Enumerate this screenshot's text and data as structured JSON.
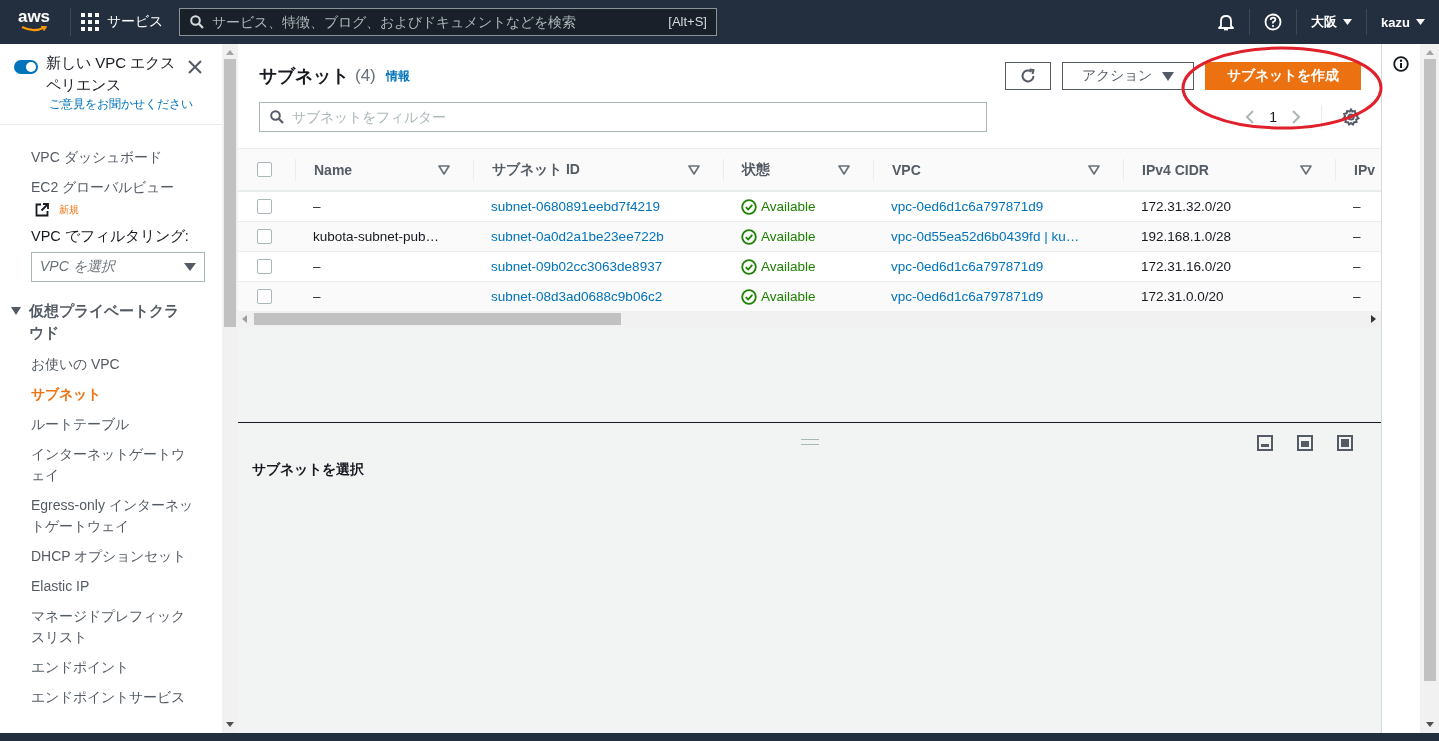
{
  "top_nav": {
    "logo": "aws",
    "services": "サービス",
    "search": {
      "placeholder": "サービス、特徴、ブログ、およびドキュメントなどを検索",
      "shortcut": "[Alt+S]"
    },
    "region": "大阪",
    "user": "kazu"
  },
  "sidebar": {
    "experience": {
      "label": "新しい VPC エクスペリエンス",
      "on": true,
      "feedback": "ご意見をお聞かせください"
    },
    "links": [
      {
        "label": "VPC ダッシュボード"
      },
      {
        "label": "EC2 グローバルビュー",
        "badge": "新規"
      }
    ],
    "filter": {
      "label": "VPC でフィルタリング:",
      "placeholder": "VPC を選択"
    },
    "section": {
      "label": "仮想プライベートクラウド",
      "expanded": true,
      "children": [
        {
          "label": "お使いの VPC",
          "selected": false
        },
        {
          "label": "サブネット",
          "selected": true
        },
        {
          "label": "ルートテーブル",
          "selected": false
        },
        {
          "label": "インターネットゲートウェイ",
          "selected": false
        },
        {
          "label": "Egress-only インターネットゲートウェイ",
          "selected": false
        },
        {
          "label": "DHCP オプションセット",
          "selected": false
        },
        {
          "label": "Elastic IP",
          "selected": false
        },
        {
          "label": "マネージドプレフィックスリスト",
          "selected": false
        },
        {
          "label": "エンドポイント",
          "selected": false
        },
        {
          "label": "エンドポイントサービス",
          "selected": false
        }
      ]
    }
  },
  "main": {
    "title": "サブネット",
    "count": "(4)",
    "info": "情報",
    "actions": "アクション",
    "create": "サブネットを作成",
    "filter": {
      "placeholder": "サブネットをフィルター"
    },
    "page": "1",
    "table": {
      "all_checked": false,
      "columns": [
        {
          "label": "Name"
        },
        {
          "label": "サブネット ID"
        },
        {
          "label": "状態"
        },
        {
          "label": "VPC"
        },
        {
          "label": "IPv4 CIDR"
        },
        {
          "label": "IPv"
        }
      ],
      "rows": [
        {
          "checked": false,
          "name": "–",
          "subnet_id": "subnet-0680891eebd7f4219",
          "state": {
            "kind": "available",
            "label": "Available"
          },
          "vpc": "vpc-0ed6d1c6a797871d9",
          "cidr": "172.31.32.0/20",
          "column_7": "–"
        },
        {
          "checked": false,
          "name": "kubota-subnet-pub…",
          "subnet_id": "subnet-0a0d2a1be23ee722b",
          "state": {
            "kind": "available",
            "label": "Available"
          },
          "vpc": "vpc-0d55ea52d6b0439fd | ku…",
          "cidr": "192.168.1.0/28",
          "column_7": "–"
        },
        {
          "checked": false,
          "name": "–",
          "subnet_id": "subnet-09b02cc3063de8937",
          "state": {
            "kind": "available",
            "label": "Available"
          },
          "vpc": "vpc-0ed6d1c6a797871d9",
          "cidr": "172.31.16.0/20",
          "column_7": "–"
        },
        {
          "checked": false,
          "name": "–",
          "subnet_id": "subnet-08d3ad0688c9b06c2",
          "state": {
            "kind": "available",
            "label": "Available"
          },
          "vpc": "vpc-0ed6d1c6a797871d9",
          "cidr": "172.31.0.0/20",
          "column_7": "–"
        }
      ]
    }
  },
  "split_panel": {
    "message": "サブネットを選択"
  }
}
